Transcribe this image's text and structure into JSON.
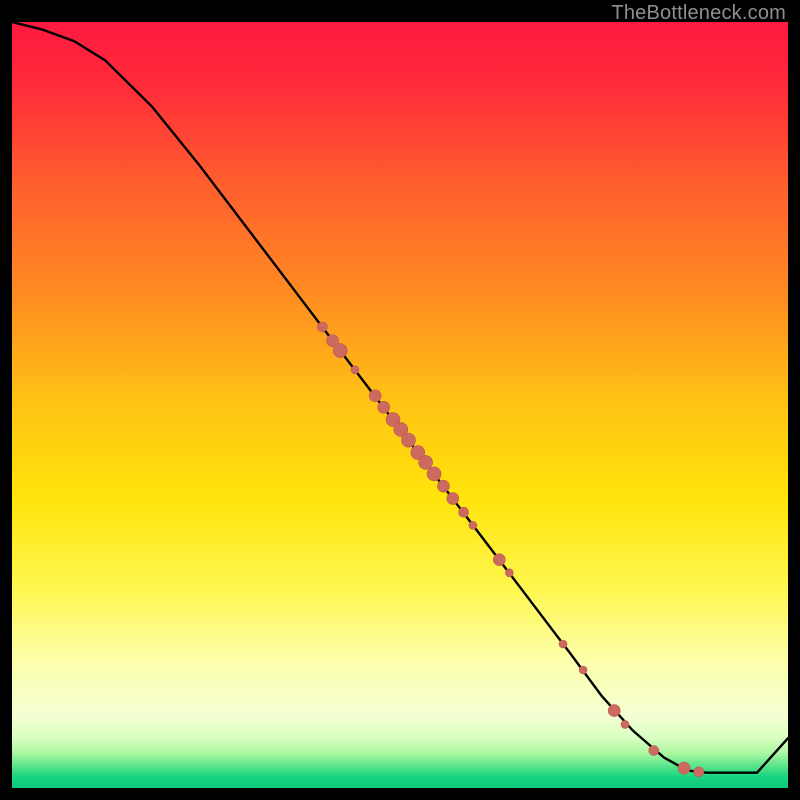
{
  "watermark": "TheBottleneck.com",
  "colors": {
    "bg": "#000000",
    "curve": "#000000",
    "dot_fill": "#cd6a60",
    "dot_stroke": "#b95a52",
    "gradient_stops": [
      {
        "offset": 0.0,
        "color": "#ff1a3f"
      },
      {
        "offset": 0.08,
        "color": "#ff2a3a"
      },
      {
        "offset": 0.2,
        "color": "#ff5a2f"
      },
      {
        "offset": 0.35,
        "color": "#ff8a22"
      },
      {
        "offset": 0.5,
        "color": "#ffc414"
      },
      {
        "offset": 0.62,
        "color": "#ffe40a"
      },
      {
        "offset": 0.74,
        "color": "#fff750"
      },
      {
        "offset": 0.84,
        "color": "#fcffb0"
      },
      {
        "offset": 0.905,
        "color": "#f4ffd2"
      },
      {
        "offset": 0.935,
        "color": "#d8ffc0"
      },
      {
        "offset": 0.955,
        "color": "#a8f7a0"
      },
      {
        "offset": 0.972,
        "color": "#56e38a"
      },
      {
        "offset": 0.985,
        "color": "#19d481"
      },
      {
        "offset": 1.0,
        "color": "#0fc97c"
      }
    ]
  },
  "chart_data": {
    "type": "line",
    "title": "",
    "xlabel": "",
    "ylabel": "",
    "xlim": [
      0,
      100
    ],
    "ylim": [
      0,
      100
    ],
    "series": [
      {
        "name": "bottleneck-curve",
        "x": [
          0,
          4,
          8,
          12,
          18,
          24,
          30,
          36,
          42,
          48,
          54,
          60,
          66,
          72,
          76,
          80,
          84,
          87,
          89.5,
          92,
          96,
          100
        ],
        "y": [
          100,
          99,
          97.5,
          95,
          89,
          81.5,
          73.5,
          65.5,
          57.5,
          49.5,
          41.5,
          33.5,
          25.5,
          17.5,
          12,
          7.5,
          4,
          2.3,
          2,
          2,
          2,
          6.5
        ]
      }
    ],
    "scatter": {
      "name": "highlighted-points",
      "points": [
        {
          "x": 40.0,
          "y": 60.2,
          "r": 5
        },
        {
          "x": 41.3,
          "y": 58.4,
          "r": 6
        },
        {
          "x": 42.3,
          "y": 57.1,
          "r": 7
        },
        {
          "x": 44.2,
          "y": 54.6,
          "r": 4
        },
        {
          "x": 46.8,
          "y": 51.2,
          "r": 6
        },
        {
          "x": 47.9,
          "y": 49.7,
          "r": 6
        },
        {
          "x": 49.1,
          "y": 48.1,
          "r": 7
        },
        {
          "x": 50.1,
          "y": 46.8,
          "r": 7
        },
        {
          "x": 51.1,
          "y": 45.4,
          "r": 7
        },
        {
          "x": 52.3,
          "y": 43.8,
          "r": 7
        },
        {
          "x": 53.3,
          "y": 42.5,
          "r": 7
        },
        {
          "x": 54.4,
          "y": 41.0,
          "r": 7
        },
        {
          "x": 55.6,
          "y": 39.4,
          "r": 6
        },
        {
          "x": 56.8,
          "y": 37.8,
          "r": 6
        },
        {
          "x": 58.2,
          "y": 36.0,
          "r": 5
        },
        {
          "x": 59.4,
          "y": 34.3,
          "r": 4
        },
        {
          "x": 62.8,
          "y": 29.8,
          "r": 6
        },
        {
          "x": 64.1,
          "y": 28.1,
          "r": 4
        },
        {
          "x": 71.0,
          "y": 18.8,
          "r": 4
        },
        {
          "x": 73.6,
          "y": 15.4,
          "r": 4
        },
        {
          "x": 77.6,
          "y": 10.1,
          "r": 6
        },
        {
          "x": 79.0,
          "y": 8.3,
          "r": 4
        },
        {
          "x": 82.7,
          "y": 4.9,
          "r": 5
        },
        {
          "x": 86.6,
          "y": 2.6,
          "r": 6
        },
        {
          "x": 88.5,
          "y": 2.1,
          "r": 5
        }
      ]
    }
  }
}
